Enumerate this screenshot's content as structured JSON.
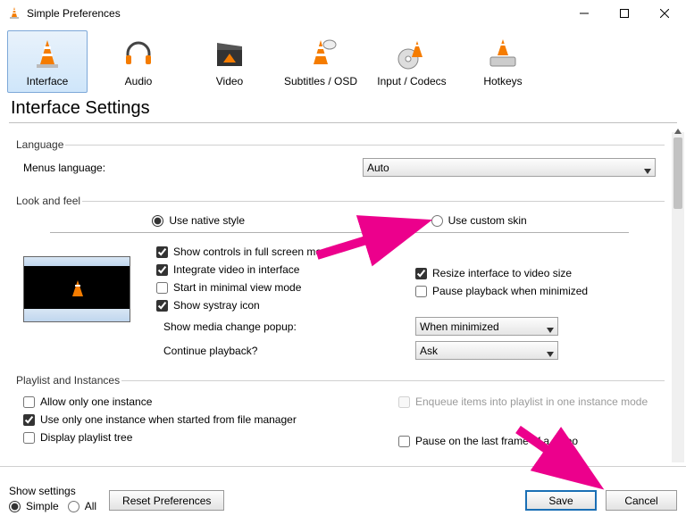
{
  "titlebar": {
    "title": "Simple Preferences"
  },
  "tabs": [
    {
      "id": "interface",
      "label": "Interface",
      "selected": true
    },
    {
      "id": "audio",
      "label": "Audio"
    },
    {
      "id": "video",
      "label": "Video"
    },
    {
      "id": "subs",
      "label": "Subtitles / OSD"
    },
    {
      "id": "input",
      "label": "Input / Codecs"
    },
    {
      "id": "hotkeys",
      "label": "Hotkeys"
    }
  ],
  "heading": "Interface Settings",
  "language": {
    "legend": "Language",
    "menus_label": "Menus language:",
    "menus_value": "Auto"
  },
  "look": {
    "legend": "Look and feel",
    "native": "Use native style",
    "custom": "Use custom skin",
    "checks": {
      "fullscreen": "Show controls in full screen mode",
      "integrate": "Integrate video in interface",
      "minimal": "Start in minimal view mode",
      "systray": "Show systray icon",
      "resize": "Resize interface to video size",
      "pausemin": "Pause playback when minimized"
    },
    "popup_label": "Show media change popup:",
    "popup_value": "When minimized",
    "continue_label": "Continue playback?",
    "continue_value": "Ask"
  },
  "playlist": {
    "legend": "Playlist and Instances",
    "one_instance": "Allow only one instance",
    "filemgr": "Use only one instance when started from file manager",
    "tree": "Display playlist tree",
    "enqueue": "Enqueue items into playlist in one instance mode",
    "pauselast": "Pause on the last frame of a video"
  },
  "bottom": {
    "show_settings": "Show settings",
    "simple": "Simple",
    "all": "All",
    "reset": "Reset Preferences",
    "save": "Save",
    "cancel": "Cancel"
  }
}
